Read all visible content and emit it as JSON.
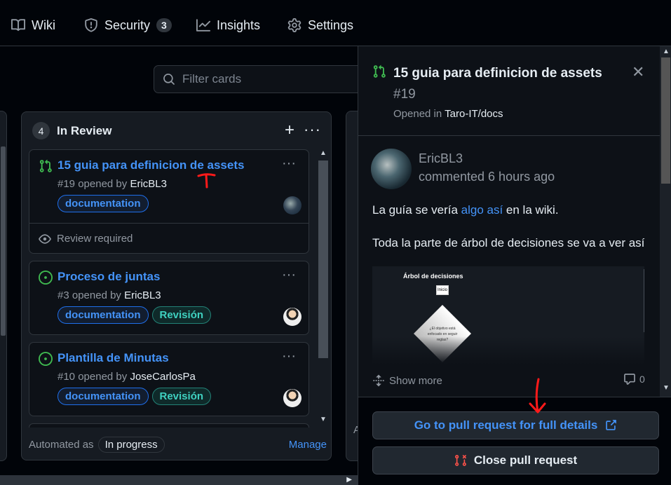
{
  "nav": {
    "wiki": "Wiki",
    "security": "Security",
    "security_count": "3",
    "insights": "Insights",
    "settings": "Settings"
  },
  "board": {
    "filter_placeholder": "Filter cards",
    "column": {
      "count": "4",
      "title": "In Review"
    },
    "cards": [
      {
        "title": "15 guia para definicion de assets",
        "number": "#19",
        "opened_by": "opened by",
        "author": "EricBL3",
        "labels": [
          "documentation"
        ],
        "review": "Review required",
        "icon": "pull-request-icon"
      },
      {
        "title": "Proceso de juntas",
        "number": "#3",
        "opened_by": "opened by",
        "author": "EricBL3",
        "labels": [
          "documentation",
          "Revisión"
        ],
        "icon": "open-issue-icon"
      },
      {
        "title": "Plantilla de Minutas",
        "number": "#10",
        "opened_by": "opened by",
        "author": "JoseCarlosPa",
        "labels": [
          "documentation",
          "Revisión"
        ],
        "icon": "open-issue-icon"
      }
    ],
    "footer": {
      "automated_as": "Automated as",
      "status": "In progress",
      "manage": "Manage",
      "next_col_letter": "A"
    }
  },
  "panel": {
    "title": "15 guia para definicion de assets",
    "number": "#19",
    "opened_in": "Opened in",
    "repo": "Taro-IT/docs",
    "comment": {
      "author": "EricBL3",
      "time": "commented 6 hours ago",
      "body1_before": "La guía se vería ",
      "body1_link": "algo así",
      "body1_after": " en la wiki.",
      "body2": "Toda la parte de árbol de decisiones se va a ver así",
      "image_title": "Árbol de decisiones",
      "image_box": "Inicio",
      "image_diamond": "¿El objetivo está enfocado en seguir reglas?",
      "show_more": "Show more",
      "comment_count": "0"
    },
    "buttons": {
      "goto": "Go to pull request for full details",
      "close": "Close pull request"
    }
  },
  "colors": {
    "link": "#4493f8",
    "green": "#3fb950",
    "danger": "#f85149",
    "annotation_red": "#ff1a1a"
  }
}
